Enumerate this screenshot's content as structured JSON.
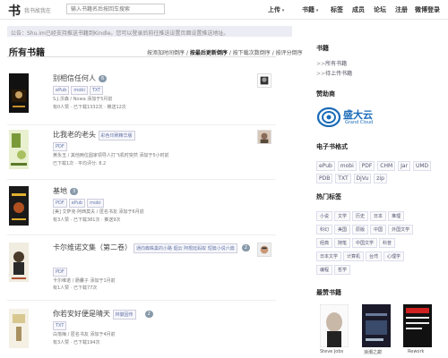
{
  "header": {
    "logo": "书",
    "slogan": "我书故我在",
    "search_placeholder": "输入书籍名后按回车搜索",
    "nav": [
      {
        "label": "上传",
        "has_dropdown": true
      },
      {
        "label": "书籍",
        "has_dropdown": true
      },
      {
        "label": "标签",
        "has_dropdown": false
      },
      {
        "label": "成员",
        "has_dropdown": false
      },
      {
        "label": "论坛",
        "has_dropdown": false
      },
      {
        "label": "注册",
        "has_dropdown": false
      },
      {
        "label": "微博登录",
        "has_dropdown": false
      }
    ]
  },
  "notice": "公告：Shu.im已经支持推送书籍到Kindle。您可以登录后前往推送设置页面设置推送地址。",
  "main": {
    "title": "所有书籍",
    "sort_options": [
      {
        "label": "按添加时间倒序",
        "active": false
      },
      {
        "label": "按最后更新倒序",
        "active": true
      },
      {
        "label": "按下载次数倒序",
        "active": false
      },
      {
        "label": "按评分倒序",
        "active": false
      }
    ],
    "sort_separator": "/",
    "books": [
      {
        "title": "别相信任何人",
        "count": "6",
        "tags": [
          "ePub",
          "mobi",
          "TXT"
        ],
        "meta1": "S.J.沃森 / Nowa 添加于5月前",
        "meta2": "有0人赞 · 已下载1332次 · 推送12次"
      },
      {
        "title": "比我老的老头",
        "subtitle": "彩色印刷精华版",
        "tags": [
          "PDF"
        ],
        "meta1": "黄永玉 / 其他两位圆家领导人打飞机时突然 添加于5小时前",
        "meta2": "已下载1次 · 平均评分: 8.2"
      },
      {
        "title": "基地",
        "count": "3",
        "tags": [
          "PDF",
          "ePub",
          "mobi"
        ],
        "meta1": "[美] 艾萨克·阿西莫夫 / 匿名书友 添加于6月前",
        "meta2": "有3人赞 · 已下载381次 · 推送9次"
      },
      {
        "title": "卡尔维诺文集（第二卷）",
        "subtitle": "通向蜘蛛巢的小路 烟云 阿根廷蚂蚁 短篇小说六篇",
        "count": "2",
        "tags": [
          "PDF"
        ],
        "meta1": "卡尔维诺 / 肠囊子 添加于1月前",
        "meta2": "有1人赞 · 已下载77次"
      },
      {
        "title": "你若安好便是晴天",
        "subtitle": "林徽因传",
        "count": "2",
        "tags": [
          "TXT"
        ],
        "meta1": "白落梅 / 匿名书友 添加于4月前",
        "meta2": "有3人赞 · 已下载194次"
      }
    ]
  },
  "sidebar": {
    "books_heading": "书籍",
    "books_links": [
      "所有书籍",
      "待上传书籍"
    ],
    "sponsor_heading": "赞助商",
    "sponsor_name": "盛大云",
    "sponsor_en": "Grand Cloud",
    "formats_heading": "电子书格式",
    "formats": [
      "ePub",
      "mobi",
      "PDF",
      "CHM",
      "Jar",
      "UMD",
      "PDB",
      "TXT",
      "DjVu",
      "zip"
    ],
    "hot_tags_heading": "热门标签",
    "hot_tags": [
      "小说",
      "文学",
      "历史",
      "日本",
      "推理",
      "科幻",
      "美国",
      "原版",
      "中国",
      "外国文学",
      "经典",
      "随笔",
      "中国文学",
      "科普",
      "日本文学",
      "计算机",
      "台湾",
      "心理学",
      "编程",
      "哲学"
    ],
    "popular_heading": "最赞书籍",
    "popular": [
      "Steve Jobs",
      "浪潮之巅",
      "Rework"
    ]
  },
  "colors": {
    "accent": "#6677aa",
    "count_badge": "#8899aa",
    "notice_bg": "#ececf4",
    "sponsor_blue": "#1a6bb8"
  }
}
